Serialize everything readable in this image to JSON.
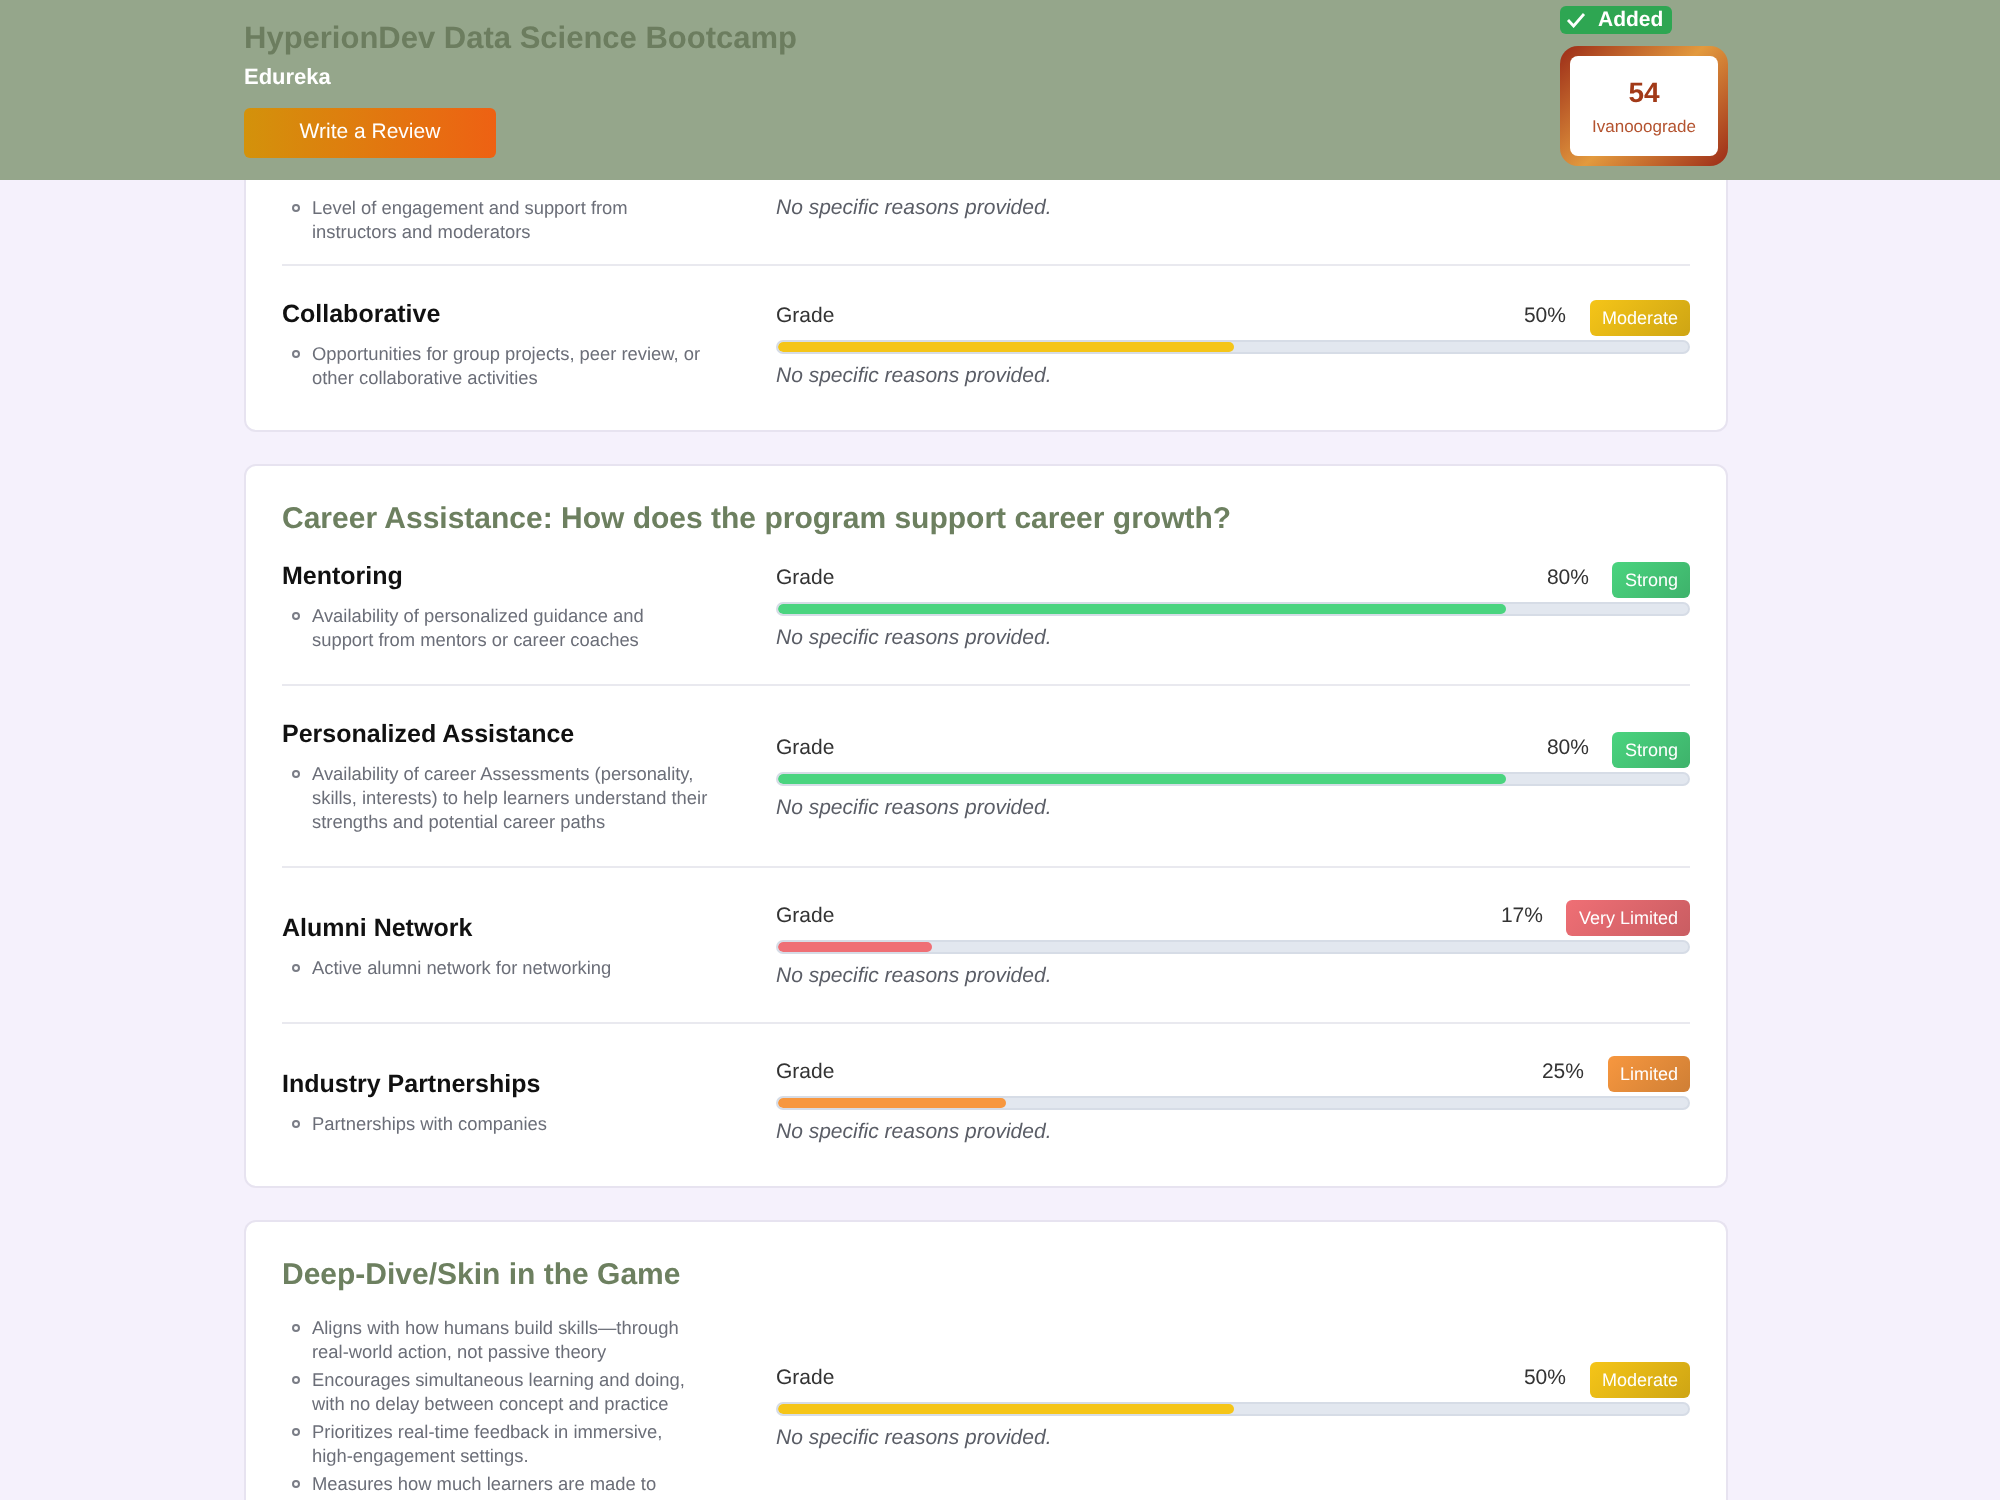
{
  "header": {
    "title": "HyperionDev Data Science Bootcamp",
    "provider": "Edureka",
    "review_button": "Write a Review",
    "status_badge": "Added",
    "score": {
      "value": "54",
      "label": "Ivanooograde"
    }
  },
  "sections": [
    {
      "items": [
        {
          "bullets": [
            "Level of engagement and support from instructors and moderators"
          ],
          "reason": "No specific reasons provided."
        },
        {
          "title": "Collaborative",
          "bullets": [
            "Opportunities for group projects, peer review, or other collaborative activities"
          ],
          "grade": {
            "label": "Grade",
            "percent": "50%",
            "level": 0.5,
            "rating": "Moderate",
            "color": "#f5c518"
          },
          "reason": "No specific reasons provided."
        }
      ]
    },
    {
      "title": "Career Assistance: How does the program support career growth?",
      "items": [
        {
          "title": "Mentoring",
          "bullets": [
            "Availability of personalized guidance and support from mentors or career coaches"
          ],
          "grade": {
            "label": "Grade",
            "percent": "80%",
            "level": 0.8,
            "rating": "Strong",
            "color": "#4ad47f"
          },
          "reason": "No specific reasons provided."
        },
        {
          "title": "Personalized Assistance",
          "bullets": [
            "Availability of career Assessments (personality, skills, interests) to help learners understand their strengths and potential career paths"
          ],
          "grade": {
            "label": "Grade",
            "percent": "80%",
            "level": 0.8,
            "rating": "Strong",
            "color": "#4ad47f"
          },
          "reason": "No specific reasons provided."
        },
        {
          "title": "Alumni Network",
          "bullets": [
            "Active alumni network for networking"
          ],
          "grade": {
            "label": "Grade",
            "percent": "17%",
            "level": 0.17,
            "rating": "Very Limited",
            "color": "#ef6f75"
          },
          "reason": "No specific reasons provided."
        },
        {
          "title": "Industry Partnerships",
          "bullets": [
            "Partnerships with companies"
          ],
          "grade": {
            "label": "Grade",
            "percent": "25%",
            "level": 0.25,
            "rating": "Limited",
            "color": "#f7973f"
          },
          "reason": "No specific reasons provided."
        }
      ]
    },
    {
      "title": "Deep-Dive/Skin in the Game",
      "items": [
        {
          "bullets": [
            "Aligns with how humans build skills—through real-world action, not passive theory",
            "Encourages simultaneous learning and doing, with no delay between concept and practice",
            "Prioritizes real-time feedback in immersive, high-engagement settings.",
            "Measures how much learners are made to"
          ],
          "grade": {
            "label": "Grade",
            "percent": "50%",
            "level": 0.5,
            "rating": "Moderate",
            "color": "#f5c518"
          },
          "reason": "No specific reasons provided."
        }
      ]
    }
  ]
}
